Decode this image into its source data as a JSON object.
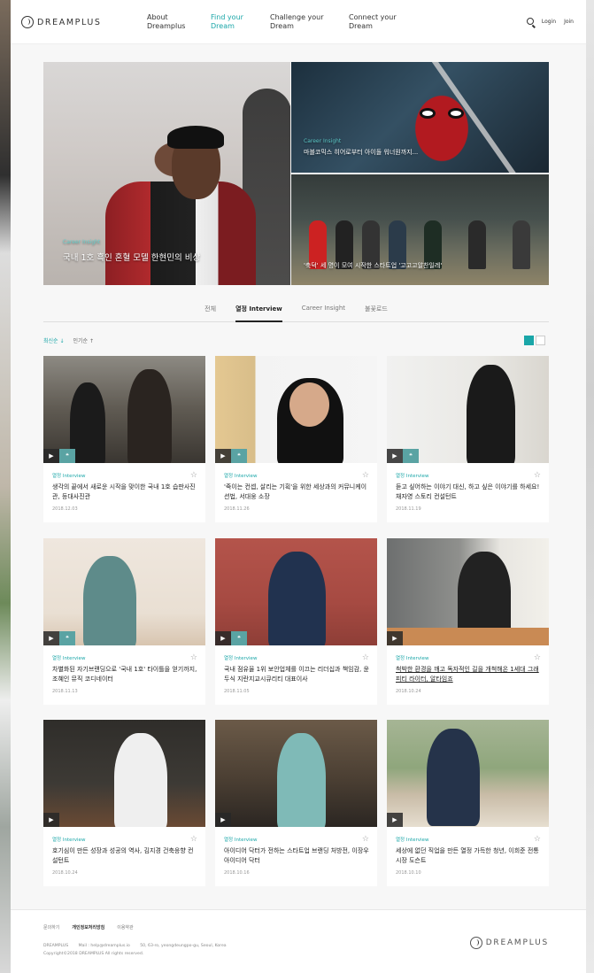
{
  "header": {
    "logo": "DREAMPLUS",
    "nav": [
      {
        "line1": "About",
        "line2": "Dreamplus"
      },
      {
        "line1": "Find your",
        "line2": "Dream"
      },
      {
        "line1": "Challenge your",
        "line2": "Dream"
      },
      {
        "line1": "Connect your",
        "line2": "Dream"
      }
    ],
    "login": "Login",
    "join": "Join"
  },
  "hero": {
    "main": {
      "tag": "Career Insight",
      "title": "국내 1호 흑인 혼혈 모델 한현민의 비상"
    },
    "top_right": {
      "tag": "Career Insight",
      "title": "마블코믹스 히어로부터 아이돌 워너원까지..."
    },
    "bottom_right": {
      "tag": "",
      "title": "'축덕' 세 명이 모여 시작한 스타트업 '고고고알찬일레'"
    }
  },
  "tabs": [
    "전체",
    "열정 Interview",
    "Career Insight",
    "불꽃로드"
  ],
  "sort": {
    "latest": "최신순 ↓",
    "popular": "인기순 ↑"
  },
  "cards": [
    {
      "tag": "열정 Interview",
      "title": "생각의 끝에서 새로운 시작을 맞이한 국내 1호 습판사진관, 등대사진관",
      "date": "2018.12.03"
    },
    {
      "tag": "열정 Interview",
      "title": "'죽이는 컨셉, 살리는 기획'을 위한 세상과의 커뮤니케이션법, 서대웅 소장",
      "date": "2018.11.26"
    },
    {
      "tag": "열정 Interview",
      "title": "듣고 싶어하는 이야기 대신, 하고 싶은 이야기를 하세요! 채자영 스토리 컨설턴트",
      "date": "2018.11.19"
    },
    {
      "tag": "열정 Interview",
      "title": "차별화된 자기브랜딩으로 '국내 1호' 타이틀을 얻기까지, 조혜인 뮤직 코디네이터",
      "date": "2018.11.13"
    },
    {
      "tag": "열정 Interview",
      "title": "국내 점유율 1위 보안업체를 이끄는 리더십과 책임감, 윤두식 지란지교시큐리티 대표이사",
      "date": "2018.11.05"
    },
    {
      "tag": "열정 Interview",
      "title": "척박한 환경을 깨고 독자적인 길을 개척해온 1세대 그래피티 라이터, 알타임죠",
      "date": "2018.10.24"
    },
    {
      "tag": "열정 Interview",
      "title": "호기심이 만든 성장과 성공의 역사, 김지경 건축응향 컨설턴트",
      "date": "2018.10.24"
    },
    {
      "tag": "열정 Interview",
      "title": "아이디어 닥터가 전하는 스타트업 브랜딩 처방전, 이장우 아이디어 닥터",
      "date": "2018.10.16"
    },
    {
      "tag": "열정 Interview",
      "title": "세상에 없던 직업을 만든 열정 가득한 청년, 이희준 전통시장 도슨트",
      "date": "2018.10.10"
    }
  ],
  "footer": {
    "links": [
      "문의하기",
      "개인정보처리방침",
      "이용약관"
    ],
    "company": "DREAMPLUS",
    "mail": "Mail : help@dreamplus.io",
    "address": "50, 63-ro, yeongdeungpo-gu, Seoul, Korea",
    "copyright": "Copyright©2018 DREAMPLUS All rights reserved.",
    "logo": "DREAMPLUS"
  },
  "colors": {
    "accent": "#1aa6a8"
  }
}
